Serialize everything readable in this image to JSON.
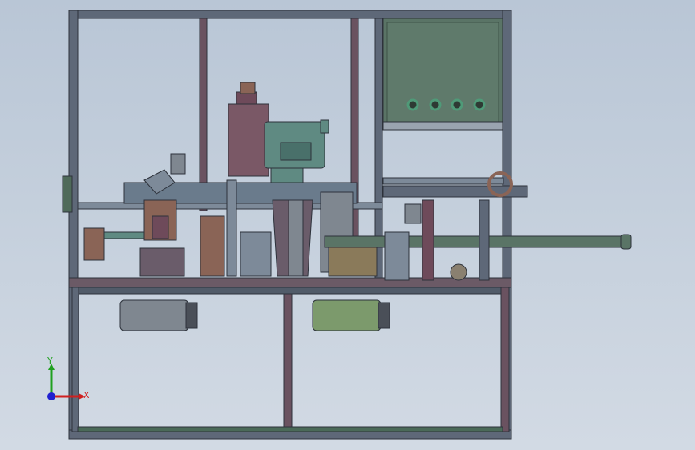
{
  "viewport": {
    "background_top": "#b9c6d6",
    "background_bottom": "#d2dae4"
  },
  "triad": {
    "x_label": "X",
    "y_label": "Y",
    "x_color": "#d02020",
    "y_color": "#20a020",
    "z_color": "#2020d0"
  },
  "colors": {
    "frame_dark": "#3a3f4a",
    "frame_face": "#5e6878",
    "frame_highlight": "#8a94a4",
    "panel_green": "#5a7466",
    "panel_green_dark": "#3e5247",
    "motor_gray": "#7f8790",
    "motor_green": "#7c9a6c",
    "part_brown": "#8a6456",
    "part_maroon": "#6e4a5a",
    "part_steel": "#7d8a99",
    "part_teal": "#5f8a82",
    "button_green": "#4f9a78"
  },
  "control_panel": {
    "buttons": [
      "button-1",
      "button-2",
      "button-3",
      "button-4"
    ]
  }
}
